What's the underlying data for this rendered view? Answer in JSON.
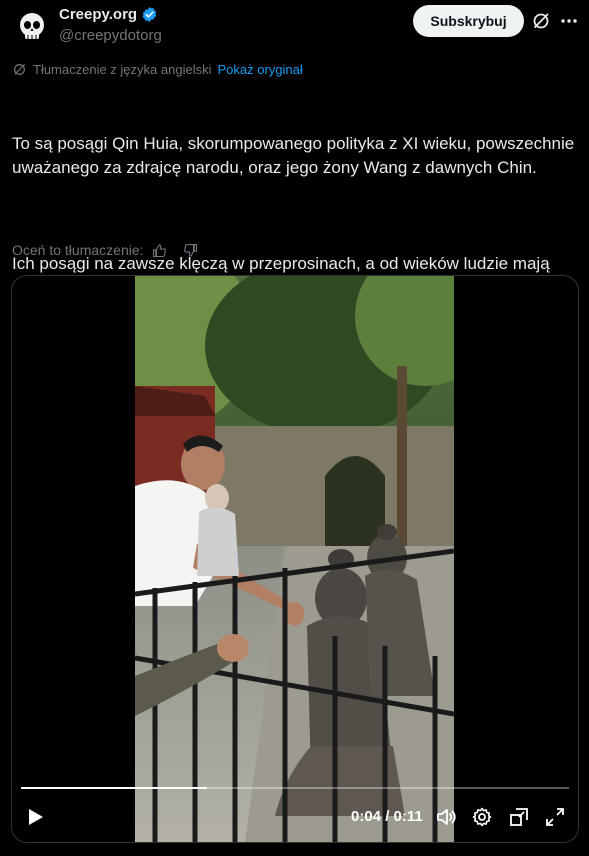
{
  "author": {
    "name": "Creepy.org",
    "handle": "@creepydotorg",
    "verified": true
  },
  "header": {
    "subscribe_label": "Subskrybuj",
    "grok_icon": "grok-icon",
    "more_icon": "more-icon"
  },
  "translation": {
    "note": "Tłumaczenie z języka angielski",
    "show_original": "Pokaż oryginał",
    "rate_label": "Oceń to tłumaczenie:"
  },
  "tweet": {
    "paragraph1": "To są posągi Qin Huia, skorumpowanego polityka z XI wieku, powszechnie uważanego za zdrajcę narodu, oraz jego żony Wang z dawnych Chin.",
    "paragraph2": "Ich posągi na zawsze klęczą w przeprosinach, a od wieków ludzie mają zwyczaj podchodzić, pluć, przeklinać, bić i kopać je."
  },
  "video": {
    "current_time": "0:04",
    "separator": "/",
    "duration": "0:11",
    "progress_fraction": 0.34
  },
  "colors": {
    "accent": "#1d9bf0",
    "background": "#000000",
    "text": "#e7e9ea",
    "muted": "#71767b"
  }
}
